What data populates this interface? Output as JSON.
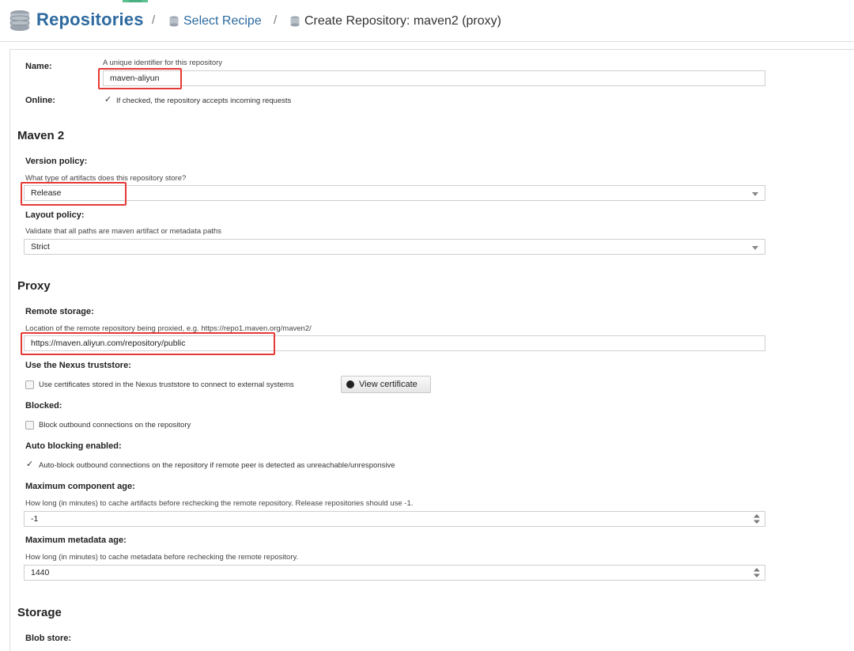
{
  "header": {
    "title": "Repositories",
    "separator": "/",
    "crumb_select": "Select Recipe",
    "crumb_current": "Create Repository: maven2 (proxy)",
    "brand_color": "#2d6a9f"
  },
  "name": {
    "label": "Name:",
    "help": "A unique identifier for this repository",
    "value": "maven-aliyun"
  },
  "online": {
    "label": "Online:",
    "text": "If checked, the repository accepts incoming requests",
    "checked": true
  },
  "maven": {
    "section": "Maven 2",
    "version_label": "Version policy:",
    "version_help": "What type of artifacts does this repository store?",
    "version_value": "Release",
    "layout_label": "Layout policy:",
    "layout_help": "Validate that all paths are maven artifact or metadata paths",
    "layout_value": "Strict"
  },
  "proxy": {
    "section": "Proxy",
    "remote_label": "Remote storage:",
    "remote_help": "Location of the remote repository being proxied, e.g. https://repo1.maven.org/maven2/",
    "remote_value": "https://maven.aliyun.com/repository/public",
    "truststore_label": "Use the Nexus truststore:",
    "truststore_text": "Use certificates stored in the Nexus truststore to connect to external systems",
    "view_cert": "View certificate",
    "blocked_label": "Blocked:",
    "blocked_text": "Block outbound connections on the repository",
    "auto_label": "Auto blocking enabled:",
    "auto_text": "Auto-block outbound connections on the repository if remote peer is detected as unreachable/unresponsive",
    "max_comp_label": "Maximum component age:",
    "max_comp_help": "How long (in minutes) to cache artifacts before rechecking the remote repository. Release repositories should use -1.",
    "max_comp_value": "-1",
    "max_meta_label": "Maximum metadata age:",
    "max_meta_help": "How long (in minutes) to cache metadata before rechecking the remote repository.",
    "max_meta_value": "1440"
  },
  "storage": {
    "section": "Storage",
    "blob_label": "Blob store:"
  },
  "highlight_color": "#e53935"
}
